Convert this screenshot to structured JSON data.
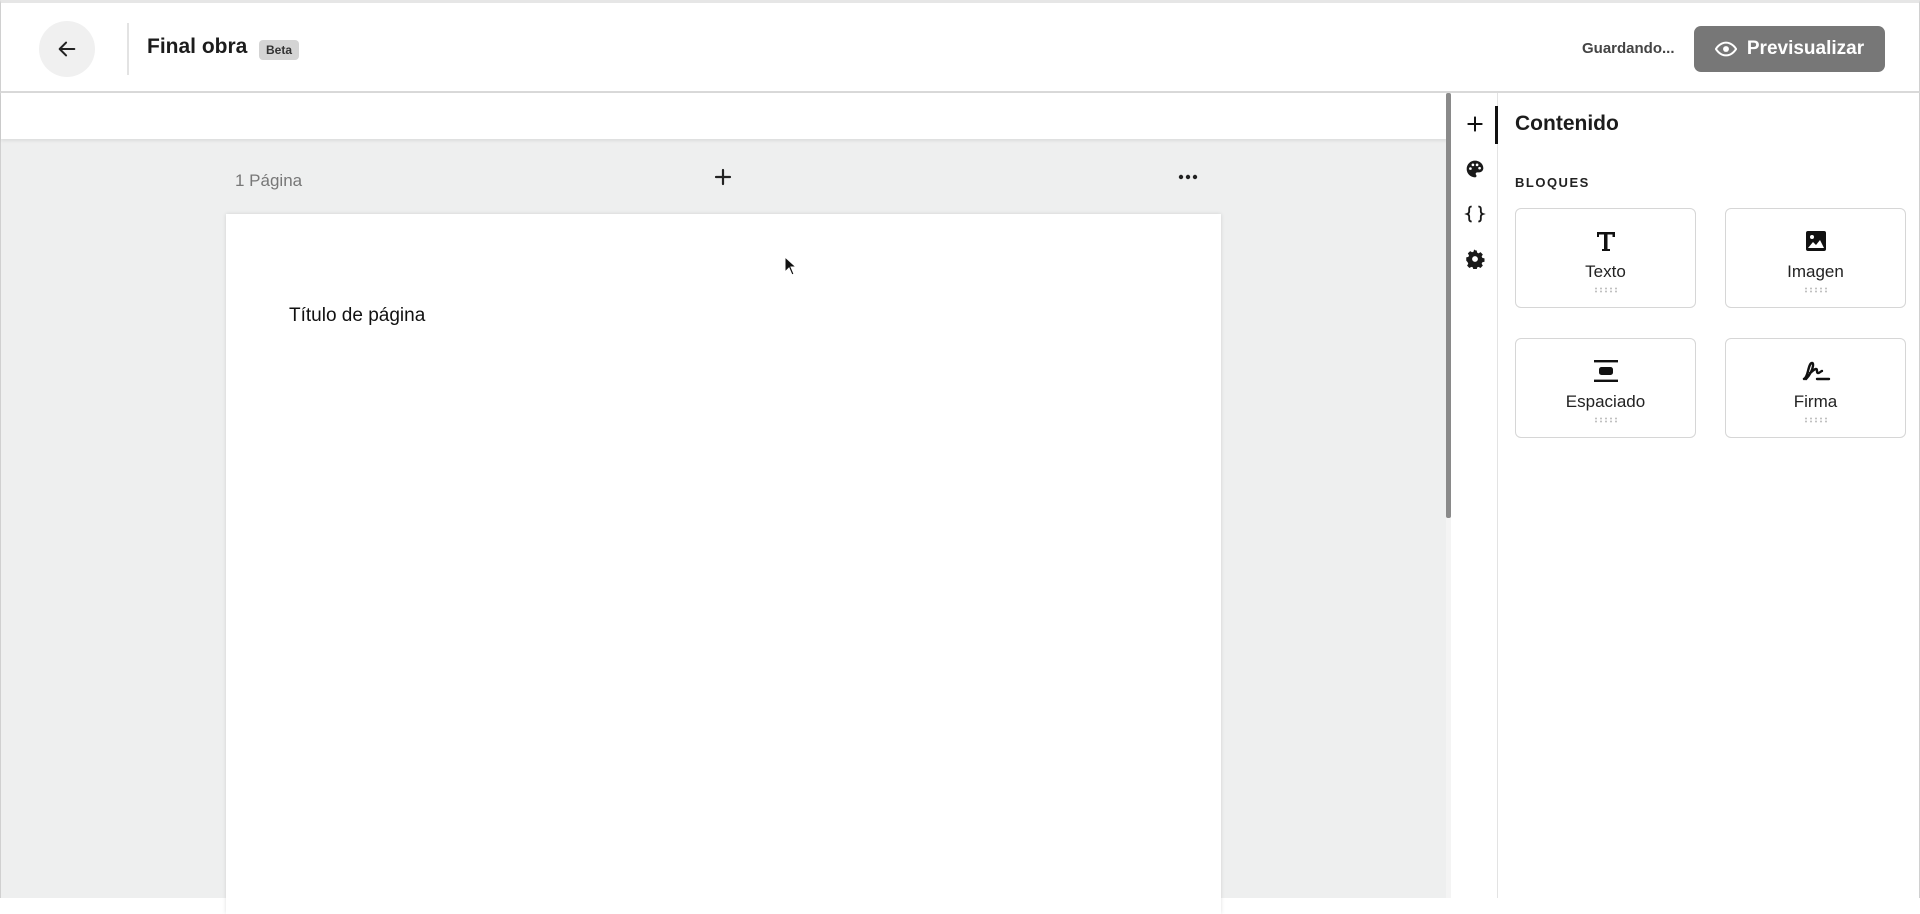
{
  "header": {
    "title": "Final obra",
    "badge": "Beta",
    "status": "Guardando...",
    "preview_label": "Previsualizar"
  },
  "canvas": {
    "page_count": "1 Página",
    "page_title": "Título de página"
  },
  "panel": {
    "title": "Contenido",
    "section_label": "BLOQUES",
    "blocks": [
      {
        "label": "Texto",
        "icon": "text-icon"
      },
      {
        "label": "Imagen",
        "icon": "image-icon"
      },
      {
        "label": "Espaciado",
        "icon": "spacing-icon"
      },
      {
        "label": "Firma",
        "icon": "signature-icon"
      }
    ]
  },
  "rail": {
    "items": [
      "add-icon",
      "palette-icon",
      "braces-icon",
      "gear-icon"
    ],
    "active": "add-icon"
  },
  "colors": {
    "preview_button": "#777777",
    "canvas_background": "#eeefef",
    "page": "#ffffff"
  }
}
